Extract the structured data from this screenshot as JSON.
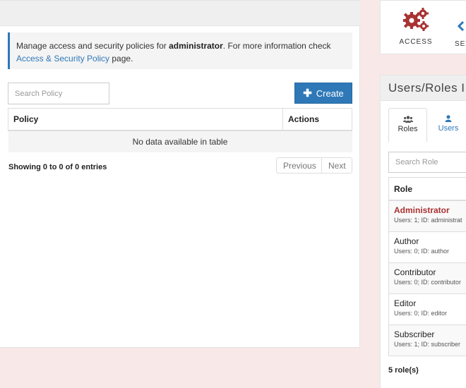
{
  "info": {
    "text_before": "Manage access and security policies for ",
    "user": "administrator",
    "text_after": ". For more information check",
    "link": "Access & Security Policy",
    "suffix": " page."
  },
  "policies": {
    "search_placeholder": "Search Policy",
    "create_label": "Create",
    "columns": [
      "Policy",
      "Actions"
    ],
    "empty_text": "No data available in table",
    "entries_info": "Showing 0 to 0 of 0 entries",
    "previous_label": "Previous",
    "next_label": "Next"
  },
  "tiles": {
    "access_label": "ACCESS",
    "settings_label": "SET",
    "access_icon": "gears-icon",
    "access_color": "#a93232"
  },
  "roles_panel": {
    "title": "Users/Roles I",
    "tabs": [
      {
        "label": "Roles",
        "icon": "users-icon"
      },
      {
        "label": "Users",
        "icon": "user-icon"
      }
    ],
    "search_placeholder": "Search Role",
    "column": "Role",
    "roles": [
      {
        "name": "Administrator",
        "meta": "Users: 1; ID: administrat"
      },
      {
        "name": "Author",
        "meta": "Users: 0; ID: author"
      },
      {
        "name": "Contributor",
        "meta": "Users: 0; ID: contributor"
      },
      {
        "name": "Editor",
        "meta": "Users: 0; ID: editor"
      },
      {
        "name": "Subscriber",
        "meta": "Users: 1; ID: subscriber"
      }
    ],
    "count": "5 role(s)"
  },
  "colors": {
    "primary": "#2e78b8",
    "danger": "#a93232",
    "background": "#f9e8e8"
  }
}
